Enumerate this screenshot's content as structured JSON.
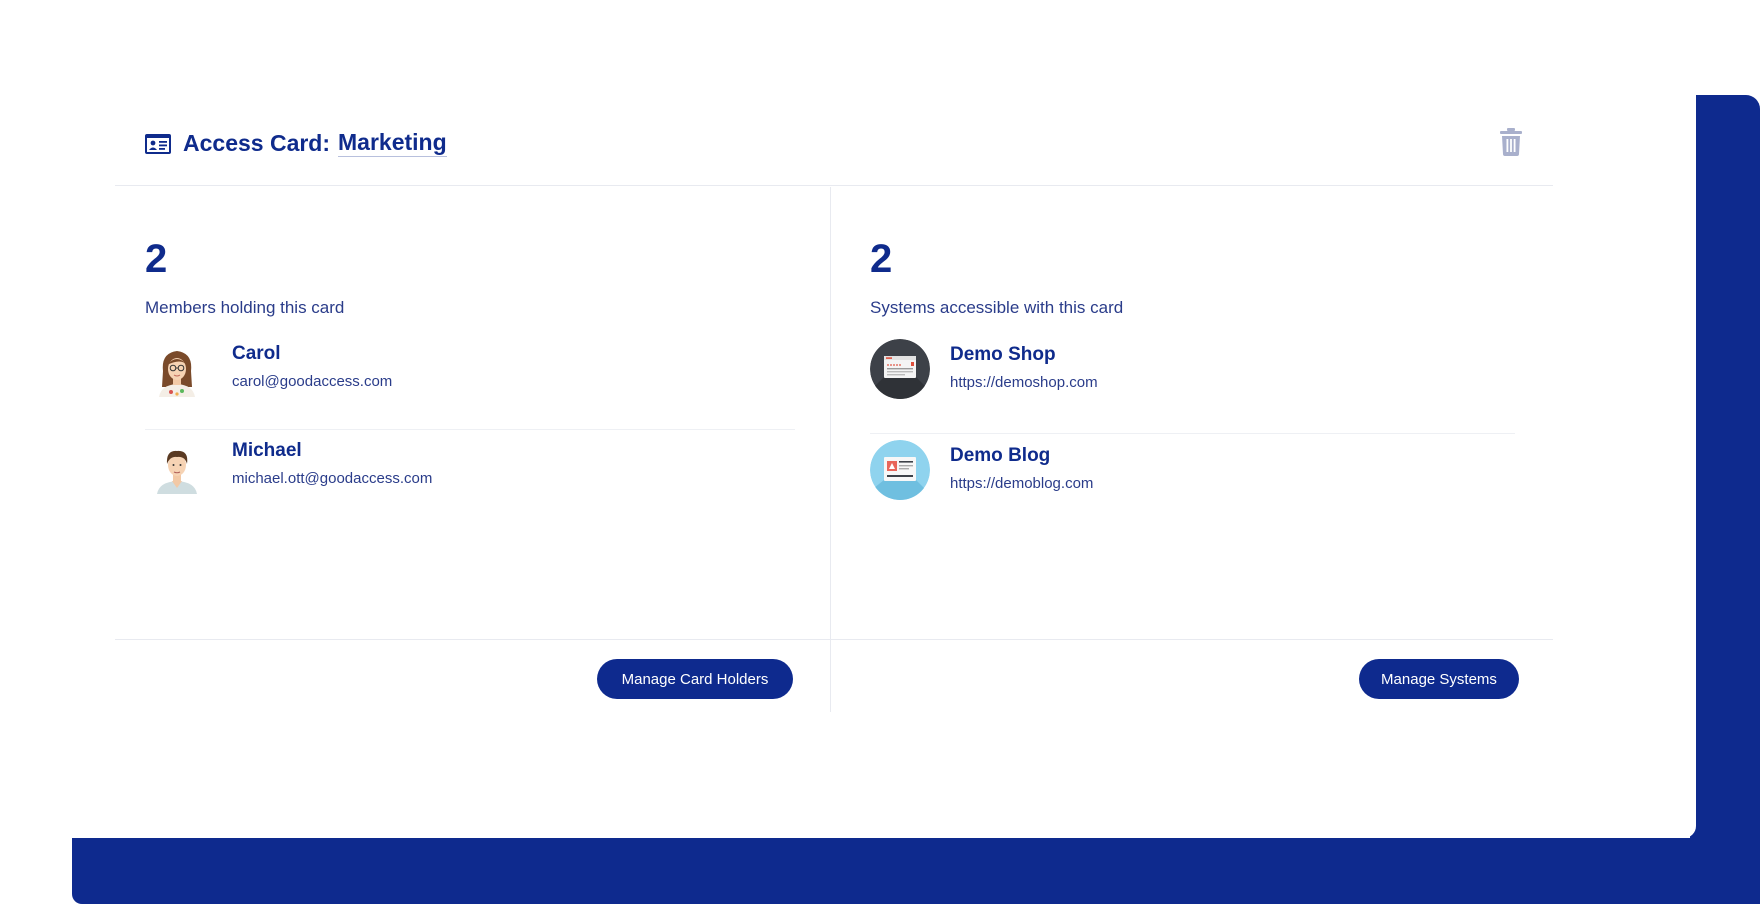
{
  "header": {
    "label": "Access Card:",
    "card_name": "Marketing",
    "icon": "id-card-icon",
    "delete_icon": "trash-icon"
  },
  "members": {
    "count": "2",
    "caption": "Members holding this card",
    "items": [
      {
        "name": "Carol",
        "email": "carol@goodaccess.com",
        "avatar": "female-avatar"
      },
      {
        "name": "Michael",
        "email": "michael.ott@goodaccess.com",
        "avatar": "male-avatar"
      }
    ],
    "button_label": "Manage Card Holders"
  },
  "systems": {
    "count": "2",
    "caption": "Systems accessible with this card",
    "items": [
      {
        "name": "Demo Shop",
        "url": "https://demoshop.com",
        "icon": "shop-webpage-icon"
      },
      {
        "name": "Demo Blog",
        "url": "https://demoblog.com",
        "icon": "blog-webpage-icon"
      }
    ],
    "button_label": "Manage Systems"
  },
  "colors": {
    "primary": "#0e2a8e",
    "text_secondary": "#2a3c8a",
    "divider": "#e8eaf0",
    "trash_icon": "#a9b0cc"
  }
}
